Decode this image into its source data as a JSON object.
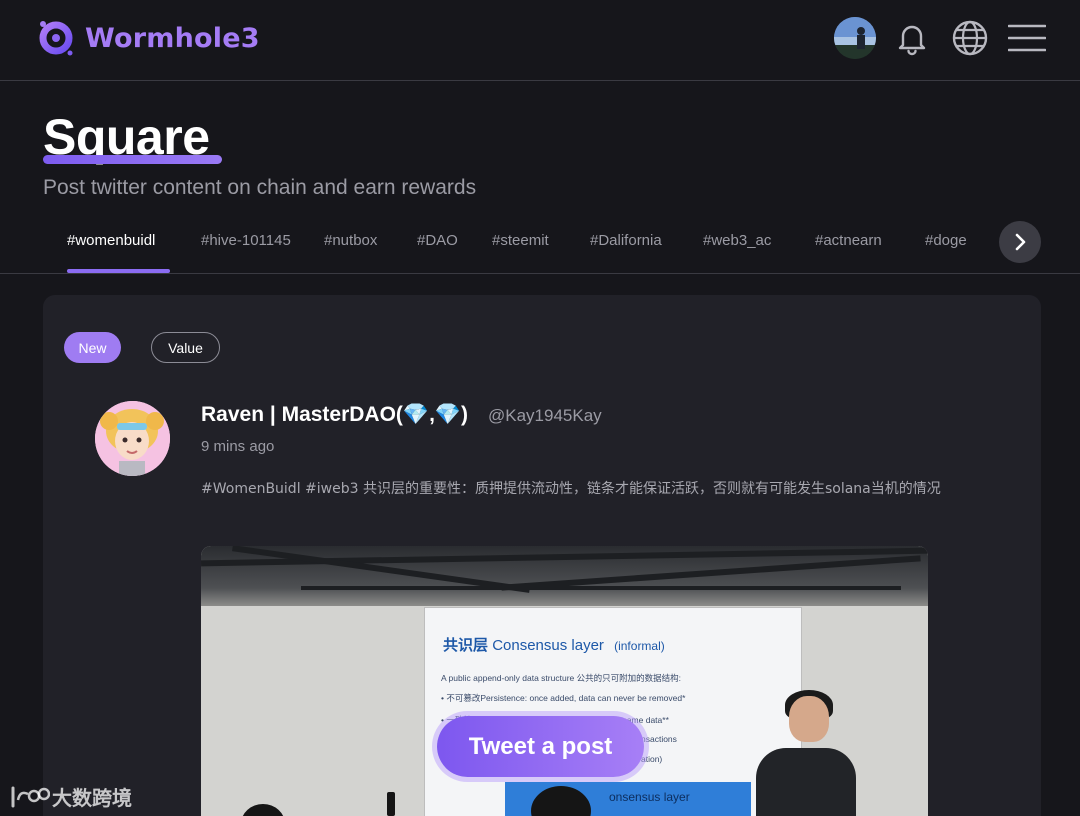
{
  "app": {
    "name": "Wormhole3",
    "brand_color": "#a57cf5"
  },
  "header": {
    "icons": [
      "user-avatar",
      "bell-icon",
      "globe-icon",
      "menu-icon"
    ]
  },
  "hero": {
    "title": "Square",
    "subtitle": "Post twitter content on chain and earn rewards"
  },
  "tabs": [
    {
      "label": "#womenbuidl",
      "active": true
    },
    {
      "label": "#hive-101145"
    },
    {
      "label": "#nutbox"
    },
    {
      "label": "#DAO"
    },
    {
      "label": "#steemit"
    },
    {
      "label": "#Dalifornia"
    },
    {
      "label": "#web3_ac"
    },
    {
      "label": "#actnearn"
    },
    {
      "label": "#doge"
    }
  ],
  "filters": {
    "new_label": "New",
    "value_label": "Value"
  },
  "post": {
    "author": "Raven | MasterDAO(💎,💎)",
    "handle": "@Kay1945Kay",
    "time": "9 mins ago",
    "content": "#WomenBuidl #iweb3 共识层的重要性：质押提供流动性，链条才能保证活跃，否则就有可能发生solana当机的情况",
    "image": {
      "slide_title_cn": "共识层",
      "slide_title_en": "Consensus layer",
      "slide_tag": "(informal)",
      "slide_line_1": "A public append-only data structure 公共的只可附加的数据结构:",
      "slide_line_2": "•   不可篡改Persistence: once added, data can never be removed*",
      "slide_line_3": "•   一致性 Safety: all honest participants have the same data**",
      "slide_line_4": "nsactions",
      "slide_line_5": "ation)",
      "slide_footer": "onsensus layer"
    }
  },
  "actions": {
    "tweet_label": "Tweet a post"
  },
  "watermark": {
    "text": "大数跨境"
  }
}
